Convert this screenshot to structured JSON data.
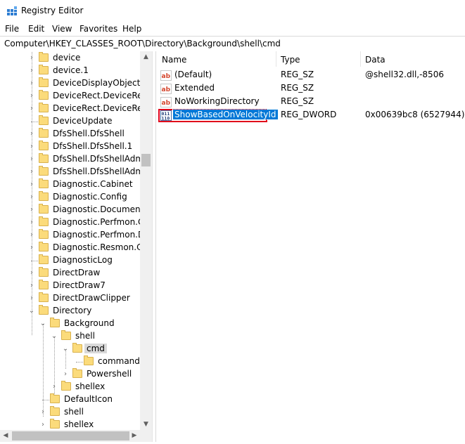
{
  "window": {
    "title": "Registry Editor"
  },
  "menu": [
    {
      "label": "File"
    },
    {
      "label": "Edit"
    },
    {
      "label": "View"
    },
    {
      "label": "Favorites"
    },
    {
      "label": "Help"
    }
  ],
  "address": {
    "path": "Computer\\HKEY_CLASSES_ROOT\\Directory\\Background\\shell\\cmd"
  },
  "tree": {
    "items": [
      {
        "label": "device",
        "expander": "›"
      },
      {
        "label": "device.1",
        "expander": "›"
      },
      {
        "label": "DeviceDisplayObject",
        "expander": "›"
      },
      {
        "label": "DeviceRect.DeviceRect",
        "expander": "›"
      },
      {
        "label": "DeviceRect.DeviceRect.",
        "expander": "›"
      },
      {
        "label": "DeviceUpdate",
        "expander": ""
      },
      {
        "label": "DfsShell.DfsShell",
        "expander": "›"
      },
      {
        "label": "DfsShell.DfsShell.1",
        "expander": "›"
      },
      {
        "label": "DfsShell.DfsShellAdmin",
        "expander": "›"
      },
      {
        "label": "DfsShell.DfsShellAdmin",
        "expander": "›"
      },
      {
        "label": "Diagnostic.Cabinet",
        "expander": "›"
      },
      {
        "label": "Diagnostic.Config",
        "expander": "›"
      },
      {
        "label": "Diagnostic.Document",
        "expander": "›"
      },
      {
        "label": "Diagnostic.Perfmon.Co",
        "expander": "›"
      },
      {
        "label": "Diagnostic.Perfmon.Do",
        "expander": "›"
      },
      {
        "label": "Diagnostic.Resmon.Cor",
        "expander": "›"
      },
      {
        "label": "DiagnosticLog",
        "expander": ""
      },
      {
        "label": "DirectDraw",
        "expander": "›"
      },
      {
        "label": "DirectDraw7",
        "expander": "›"
      },
      {
        "label": "DirectDrawClipper",
        "expander": "›"
      },
      {
        "label": "Directory",
        "expander": "⌄"
      },
      {
        "label": "Background",
        "expander": "⌄"
      },
      {
        "label": "shell",
        "expander": "⌄"
      },
      {
        "label": "cmd",
        "expander": "⌄"
      },
      {
        "label": "command",
        "expander": ""
      },
      {
        "label": "Powershell",
        "expander": "›"
      },
      {
        "label": "shellex",
        "expander": "›"
      },
      {
        "label": "DefaultIcon",
        "expander": ""
      },
      {
        "label": "shell",
        "expander": "›"
      },
      {
        "label": "shellex",
        "expander": "›"
      }
    ]
  },
  "list": {
    "columns": {
      "name": "Name",
      "type": "Type",
      "data": "Data"
    },
    "rows": [
      {
        "name": "(Default)",
        "type": "REG_SZ",
        "data": "@shell32.dll,-8506",
        "icon": "string-value-icon"
      },
      {
        "name": "Extended",
        "type": "REG_SZ",
        "data": "",
        "icon": "string-value-icon"
      },
      {
        "name": "NoWorkingDirectory",
        "type": "REG_SZ",
        "data": "",
        "icon": "string-value-icon"
      },
      {
        "name": "ShowBasedOnVelocityId",
        "type": "REG_DWORD",
        "data": "0x00639bc8 (6527944)",
        "icon": "dword-value-icon"
      }
    ]
  },
  "colors": {
    "selection": "#0078d7",
    "highlight_border": "#e0001b",
    "folder": "#fbdb7b"
  }
}
